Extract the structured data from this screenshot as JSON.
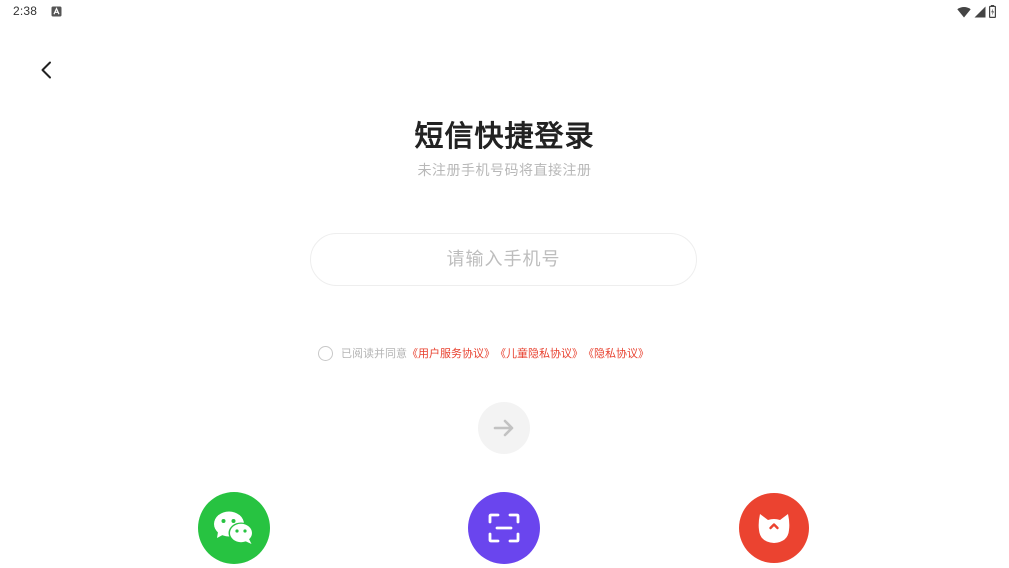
{
  "status_bar": {
    "time": "2:38",
    "notification_icon": "a-letter-icon",
    "wifi_icon": "wifi-icon",
    "signal_icon": "signal-icon",
    "battery_icon": "battery-icon"
  },
  "header": {
    "back_icon": "chevron-left-icon"
  },
  "main": {
    "title": "短信快捷登录",
    "subtitle": "未注册手机号码将直接注册",
    "phone_input": {
      "value": "",
      "placeholder": "请输入手机号"
    },
    "agreement": {
      "checked": false,
      "prefix": "已阅读并同意",
      "links": [
        "《用户服务协议》",
        "《儿童隐私协议》",
        "《隐私协议》"
      ]
    },
    "next_icon": "arrow-right-icon"
  },
  "social_login": [
    {
      "name": "wechat",
      "icon": "wechat-icon",
      "color": "#27c341"
    },
    {
      "name": "scan",
      "icon": "scan-icon",
      "color": "#6a45ee"
    },
    {
      "name": "cat",
      "icon": "cat-face-icon",
      "color": "#eb4330"
    }
  ],
  "colors": {
    "accent_link": "#e8412f",
    "title": "#222222",
    "subtitle": "#b8b8b8",
    "placeholder": "#bdbdbd",
    "next_button_bg": "#f3f3f3"
  }
}
